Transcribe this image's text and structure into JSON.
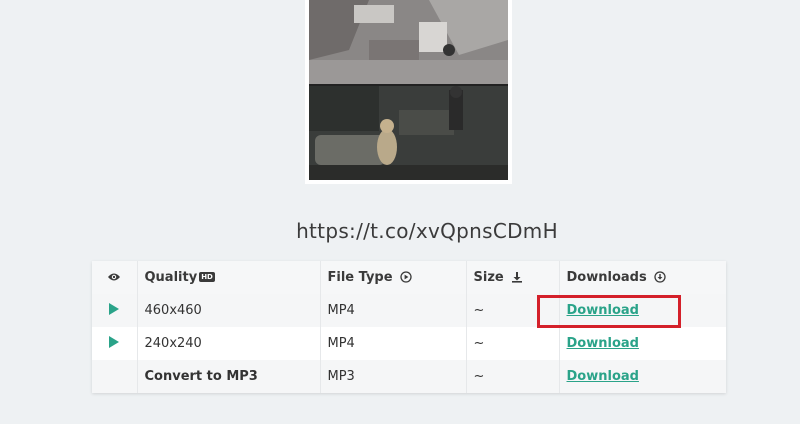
{
  "media": {
    "url_text": "https://t.co/xvQpnsCDmH"
  },
  "table": {
    "headers": {
      "quality": "Quality",
      "quality_badge": "HD",
      "file_type": "File Type",
      "size": "Size",
      "downloads": "Downloads"
    },
    "rows": [
      {
        "quality": "460x460",
        "file_type": "MP4",
        "size": "~",
        "download_label": "Download",
        "has_play": true
      },
      {
        "quality": "240x240",
        "file_type": "MP4",
        "size": "~",
        "download_label": "Download",
        "has_play": true
      },
      {
        "quality": "Convert to MP3",
        "file_type": "MP3",
        "size": "~",
        "download_label": "Download",
        "has_play": false
      }
    ]
  },
  "colors": {
    "accent": "#2aa389",
    "highlight": "#d4202a",
    "background": "#eef1f3"
  },
  "icons": {
    "eye_header": "eye-icon",
    "file_type_header": "play-circle-icon",
    "size_header": "download-arrow-icon",
    "downloads_header": "download-circle-icon",
    "row_play": "play-icon"
  }
}
